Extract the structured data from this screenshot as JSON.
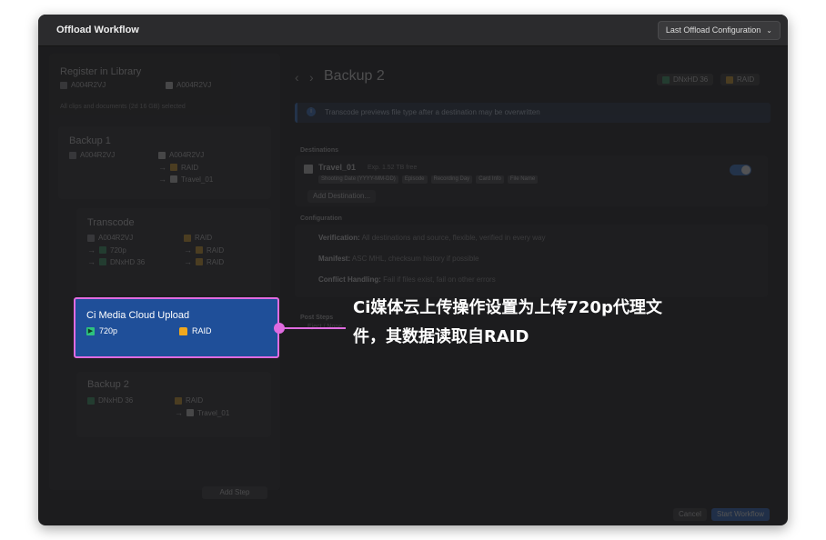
{
  "window": {
    "title": "Offload Workflow",
    "config_dropdown": "Last Offload Configuration"
  },
  "left": {
    "register": {
      "title": "Register in Library",
      "source": "A004R2VJ",
      "device": "A004R2VJ",
      "note": "All clips and documents (2d 16 GB) selected"
    },
    "backup1": {
      "title": "Backup 1",
      "source": "A004R2VJ",
      "drive": "A004R2VJ",
      "dest1": "RAID",
      "dest2": "Travel_01"
    },
    "transcode": {
      "title": "Transcode",
      "source": "A004R2VJ",
      "target": "RAID",
      "r1_left": "720p",
      "r1_right": "RAID",
      "r2_left": "DNxHD 36",
      "r2_right": "RAID"
    },
    "upload": {
      "title": "Ci Media Cloud Upload",
      "proxy": "720p",
      "source": "RAID"
    },
    "backup2": {
      "title": "Backup 2",
      "source": "DNxHD 36",
      "dest1": "RAID",
      "dest2": "Travel_01"
    },
    "bottom_button": "Add Step"
  },
  "right": {
    "header_title": "Backup 2",
    "tag1": "DNxHD 36",
    "tag2": "RAID",
    "banner": "Transcode previews file type after a destination may be overwritten",
    "destinations_label": "Destinations",
    "dest_name": "Travel_01",
    "dest_meta": "Exp. 1.52 TB free",
    "path_chips": [
      "Shooting Date (YYYY-MM-DD)",
      "Episode",
      "Recording Day",
      "Card Info",
      "File Name"
    ],
    "add_dest": "Add Destination...",
    "configuration_label": "Configuration",
    "verification_label": "Verification:",
    "verification_val": "All destinations and source, flexible, verified in every way",
    "manifest_label": "Manifest:",
    "manifest_val": "ASC MHL, checksum history if possible",
    "conflict_label": "Conflict Handling:",
    "conflict_val": "Fail if files exist, fail on other errors",
    "post_steps_label": "Post Steps",
    "post_step_val": "Eject / None",
    "cancel": "Cancel",
    "start": "Start Workflow"
  },
  "callout": {
    "line1": "Ci媒体云上传操作设置为上传720p代理文",
    "line2": "件，其数据读取自RAID"
  },
  "colors": {
    "highlight_border": "#e06be0",
    "highlight_fill": "#1f4f99",
    "window_bg": "#1c1c1e"
  }
}
